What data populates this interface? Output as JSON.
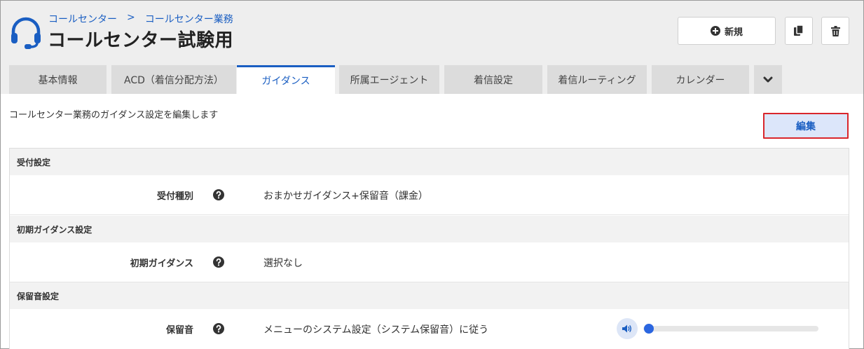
{
  "breadcrumb": {
    "parent": "コールセンター",
    "separator": ">",
    "current": "コールセンター業務"
  },
  "title": "コールセンター試験用",
  "toolbar": {
    "new_label": "新規",
    "new_icon": "plus-circle-icon",
    "copy_icon": "copy-icon",
    "delete_icon": "trash-icon"
  },
  "tabs": [
    {
      "label": "基本情報",
      "active": false
    },
    {
      "label": "ACD（着信分配方法）",
      "active": false
    },
    {
      "label": "ガイダンス",
      "active": true
    },
    {
      "label": "所属エージェント",
      "active": false
    },
    {
      "label": "着信設定",
      "active": false
    },
    {
      "label": "着信ルーティング",
      "active": false
    },
    {
      "label": "カレンダー",
      "active": false
    }
  ],
  "description": "コールセンター業務のガイダンス設定を編集します",
  "edit_label": "編集",
  "sections": [
    {
      "title": "受付設定",
      "label": "受付種別",
      "value": "おまかせガイダンス+保留音（課金）"
    },
    {
      "title": "初期ガイダンス設定",
      "label": "初期ガイダンス",
      "value": "選択なし"
    },
    {
      "title": "保留音設定",
      "label": "保留音",
      "value": "メニューのシステム設定（システム保留音）に従う"
    }
  ],
  "audio": {
    "icon": "volume-icon",
    "progress": 0
  },
  "colors": {
    "accent": "#1a5ec2",
    "edit_border": "#d9262c",
    "edit_bg": "#dce6fa"
  }
}
